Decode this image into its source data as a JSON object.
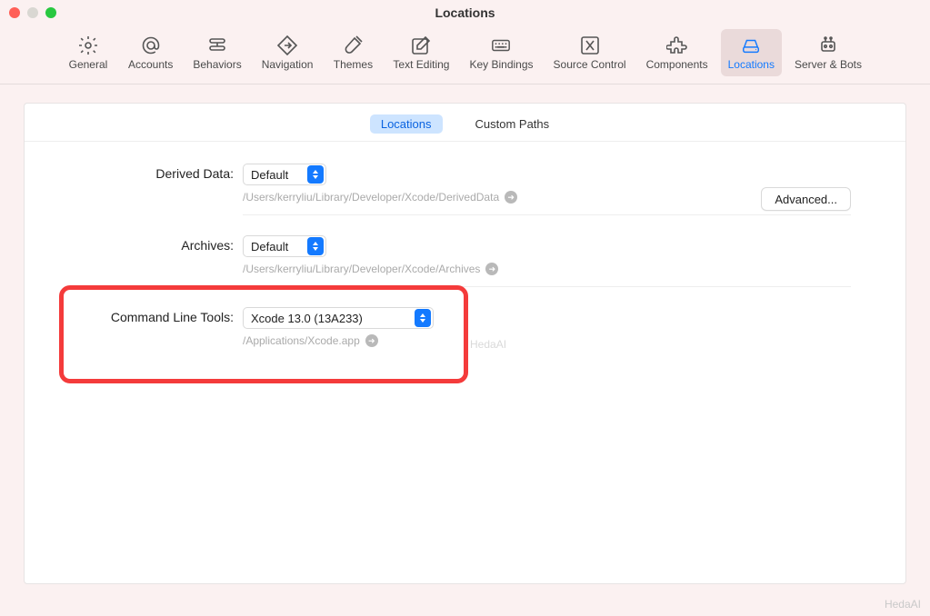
{
  "window": {
    "title": "Locations"
  },
  "toolbar": {
    "items": [
      {
        "id": "general",
        "label": "General",
        "icon": "gear"
      },
      {
        "id": "accounts",
        "label": "Accounts",
        "icon": "at"
      },
      {
        "id": "behaviors",
        "label": "Behaviors",
        "icon": "stack"
      },
      {
        "id": "navigation",
        "label": "Navigation",
        "icon": "diamond"
      },
      {
        "id": "themes",
        "label": "Themes",
        "icon": "brush"
      },
      {
        "id": "text-editing",
        "label": "Text Editing",
        "icon": "pencil-square"
      },
      {
        "id": "key-bindings",
        "label": "Key Bindings",
        "icon": "keyboard"
      },
      {
        "id": "source-control",
        "label": "Source Control",
        "icon": "branch"
      },
      {
        "id": "components",
        "label": "Components",
        "icon": "puzzle"
      },
      {
        "id": "locations",
        "label": "Locations",
        "icon": "drive",
        "selected": true
      },
      {
        "id": "server-bots",
        "label": "Server & Bots",
        "icon": "robot"
      }
    ]
  },
  "tabs": [
    {
      "id": "locations",
      "label": "Locations",
      "active": true
    },
    {
      "id": "custom-paths",
      "label": "Custom Paths",
      "active": false
    }
  ],
  "settings": {
    "derived_data": {
      "label": "Derived Data:",
      "value": "Default",
      "path": "/Users/kerryliu/Library/Developer/Xcode/DerivedData",
      "advanced_button": "Advanced..."
    },
    "archives": {
      "label": "Archives:",
      "value": "Default",
      "path": "/Users/kerryliu/Library/Developer/Xcode/Archives"
    },
    "clt": {
      "label": "Command Line Tools:",
      "value": "Xcode 13.0 (13A233)",
      "path": "/Applications/Xcode.app"
    }
  },
  "watermark": "HedaAI"
}
